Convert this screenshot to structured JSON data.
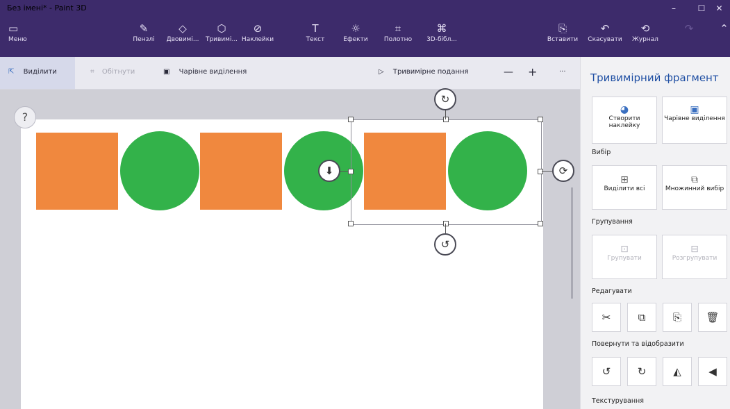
{
  "window": {
    "title": "Без імені* - Paint 3D",
    "minimize": "–",
    "maximize": "☐",
    "close": "✕"
  },
  "ribbon": {
    "menu": {
      "icon": "folder-icon",
      "label": "Меню"
    },
    "tools": [
      {
        "icon": "brush-icon",
        "label": "Пензлі"
      },
      {
        "icon": "2d-shapes-icon",
        "label": "Двовимі..."
      },
      {
        "icon": "3d-shapes-icon",
        "label": "Тривимі..."
      },
      {
        "icon": "stickers-icon",
        "label": "Наклейки"
      },
      {
        "icon": "text-icon",
        "label": "Текст"
      },
      {
        "icon": "effects-icon",
        "label": "Ефекти"
      },
      {
        "icon": "canvas-icon",
        "label": "Полотно"
      },
      {
        "icon": "3d-library-icon",
        "label": "3D-бібл..."
      }
    ],
    "right_tools": [
      {
        "icon": "paste-icon",
        "label": "Вставити"
      },
      {
        "icon": "undo-icon",
        "label": "Скасувати"
      },
      {
        "icon": "history-icon",
        "label": "Журнал"
      }
    ]
  },
  "toolbar": {
    "select": "Виділити",
    "crop": "Обітнути",
    "magic_select": "Чарівне виділення",
    "view_3d": "Тривимірне подання",
    "zoom_out": "—",
    "zoom_in": "+",
    "more": "···"
  },
  "canvas": {
    "help": "?"
  },
  "panel": {
    "title": "Тривимірний фрагмент",
    "make_sticker": "Створити наклейку",
    "magic_select": "Чарівне виділення",
    "section_select": "Вибір",
    "select_all": "Виділити всі",
    "multi_select": "Множинний вибір",
    "section_group": "Групування",
    "group": "Групувати",
    "ungroup": "Розгрупувати",
    "section_edit": "Редагувати",
    "section_rotate": "Повернути та відобразити",
    "section_texture": "Текстурування"
  },
  "colors": {
    "orange": "#f0883e",
    "green": "#33b24a",
    "accent": "#1f4fa3",
    "chrome": "#3d2b6b"
  }
}
